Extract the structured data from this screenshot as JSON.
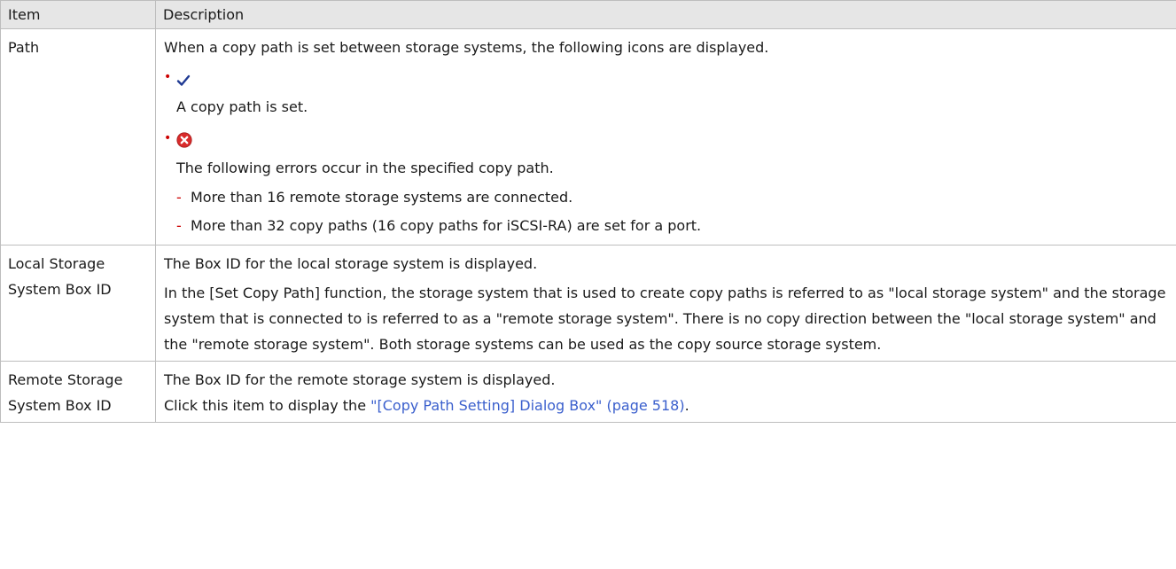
{
  "table": {
    "headers": {
      "item": "Item",
      "description": "Description"
    },
    "rows": {
      "path": {
        "item": "Path",
        "intro": "When a copy path is set between storage systems, the following icons are displayed.",
        "bullet1": {
          "icon": "checkmark-icon",
          "text": "A copy path is set."
        },
        "bullet2": {
          "icon": "error-x-icon",
          "text": "The following errors occur in the specified copy path.",
          "sub": [
            "More than 16 remote storage systems are connected.",
            "More than 32 copy paths (16 copy paths for iSCSI-RA) are set for a port."
          ]
        }
      },
      "local": {
        "item": "Local Storage System Box ID",
        "line1": "The Box ID for the local storage system is displayed.",
        "line2": "In the [Set Copy Path] function, the storage system that is used to create copy paths is referred to as \"local storage system\" and the storage system that is connected to is referred to as a \"remote storage system\". There is no copy direction between the \"local storage system\" and the \"remote storage system\". Both storage systems can be used as the copy source storage system."
      },
      "remote": {
        "item": "Remote Storage System Box ID",
        "line1": "The Box ID for the remote storage system is displayed.",
        "line2_prefix": "Click this item to display the ",
        "link_text": "\"[Copy Path Setting] Dialog Box\" (page 518)",
        "line2_suffix": "."
      }
    }
  },
  "colors": {
    "header_bg": "#e6e6e6",
    "border": "#bdbdbd",
    "bullet_red": "#cc0000",
    "check_blue": "#1f3a93",
    "error_red": "#d92b2b",
    "link_blue": "#3a5fcd"
  }
}
